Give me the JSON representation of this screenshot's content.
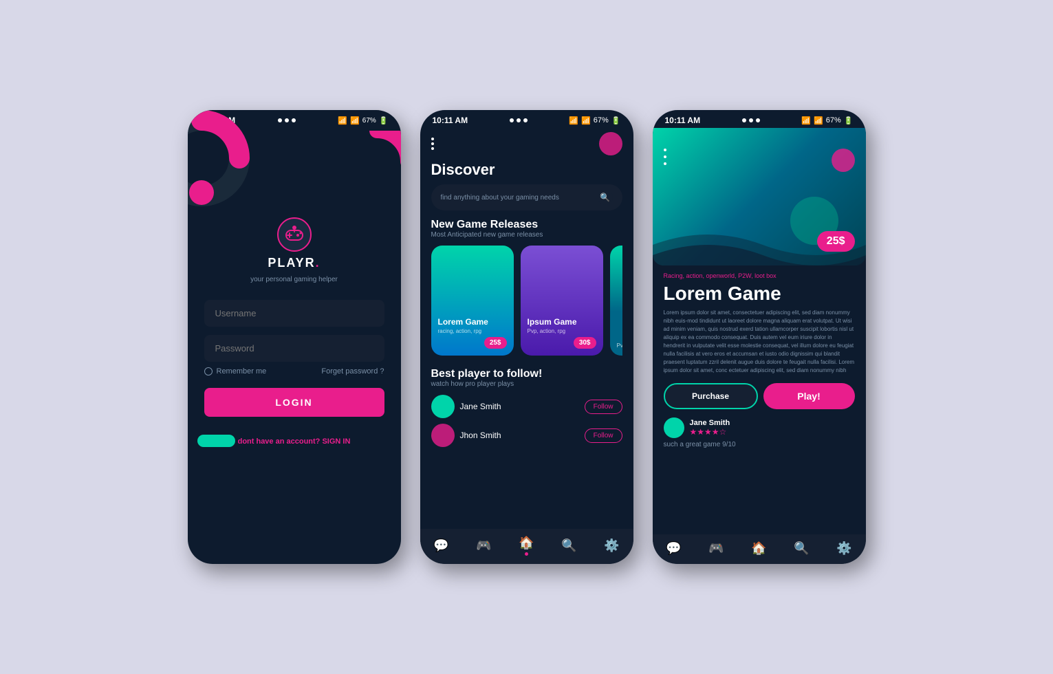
{
  "phone1": {
    "statusBar": {
      "time": "10:11 AM",
      "battery": "67%"
    },
    "logo": {
      "name": "PLAYR.",
      "tagline": "your personal gaming helper"
    },
    "form": {
      "usernamePlaceholder": "Username",
      "passwordPlaceholder": "Password",
      "rememberMe": "Remember me",
      "forgetPassword": "Forget password ?",
      "loginButton": "LOGIN"
    },
    "signup": {
      "text": "dont have an account?",
      "link": "SIGN IN"
    }
  },
  "phone2": {
    "statusBar": {
      "time": "10:11 AM",
      "battery": "67%"
    },
    "discoverTitle": "Discover",
    "searchPlaceholder": "find anything about your gaming needs",
    "newGames": {
      "title": "New Game Releases",
      "subtitle": "Most Anticipated  new game releases",
      "games": [
        {
          "name": "Lorem Game",
          "tags": "racing, action, rpg",
          "price": "25$"
        },
        {
          "name": "Ipsum Game",
          "tags": "Pvp, action, rpg",
          "price": "30$"
        },
        {
          "name": "",
          "tags": "Pvp, act...",
          "price": ""
        }
      ]
    },
    "bestPlayers": {
      "title": "Best player to follow!",
      "subtitle": "watch how pro player plays",
      "players": [
        {
          "name": "Jane Smith"
        },
        {
          "name": "Jhon Smith"
        }
      ],
      "followLabel": "Follow"
    },
    "bottomNav": [
      {
        "icon": "💬",
        "active": false
      },
      {
        "icon": "🎮",
        "active": false
      },
      {
        "icon": "🏠",
        "active": true
      },
      {
        "icon": "🔍",
        "active": false
      },
      {
        "icon": "⚙",
        "active": false
      }
    ]
  },
  "phone3": {
    "statusBar": {
      "time": "10:11 AM",
      "battery": "67%"
    },
    "price": "25$",
    "gameTags": "Racing, action, openworld, P2W, loot box",
    "gameTitle": "Lorem Game",
    "gameDescription": "Lorem ipsum dolor sit amet, consectetuer adipiscing elit, sed diam nonummy nibh euis-mod tindidunt ut laoreet dolore magna aliquam erat volutpat. Ut wisi ad minim veniam, quis nostrud exerd tation ullamcorper suscipit lobortis nisl ut aliquip ex ea commodo consequat. Duis autem vel eum iriure dolor in hendrerit in vulputate velit esse molestie consequat, vel illum dolore eu feugiat nulla facilisis at vero eros et accumsan et iusto odio dignissim qui blandit praesent luptatum zzril delenit augue duis dolore te feugait nulla facilisi.\nLorem ipsum dolor sit amet, conc ectetuer adipiscing elit, sed diam nonummy nibh",
    "purchaseLabel": "Purchase",
    "playLabel": "Play!",
    "review": {
      "reviewerName": "Jane Smith",
      "stars": "★★★★☆",
      "reviewText": "such a great game 9/10"
    },
    "bottomNav": [
      {
        "icon": "💬",
        "active": false
      },
      {
        "icon": "🎮",
        "active": false
      },
      {
        "icon": "🏠",
        "active": false
      },
      {
        "icon": "🔍",
        "active": false
      },
      {
        "icon": "⚙",
        "active": false
      }
    ]
  }
}
